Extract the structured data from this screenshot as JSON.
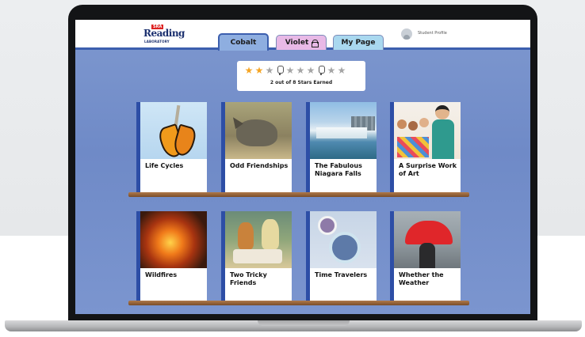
{
  "header": {
    "logo": {
      "badge": "SRA",
      "name": "Reading",
      "sub": "LABORATORY"
    },
    "tabs": [
      {
        "label": "Cobalt",
        "active": true
      },
      {
        "label": "Violet",
        "locked": true
      },
      {
        "label": "My Page"
      }
    ],
    "profile_label": "Student Profile"
  },
  "stars": {
    "earned": 2,
    "total": 8,
    "label": "2 out of 8 Stars Earned"
  },
  "books": [
    {
      "title": "Life Cycles"
    },
    {
      "title": "Odd Friendships"
    },
    {
      "title": "The Fabulous Niagara Falls"
    },
    {
      "title": "A Surprise Work of Art"
    },
    {
      "title": "Wildfires"
    },
    {
      "title": "Two Tricky Friends"
    },
    {
      "title": "Time Travelers"
    },
    {
      "title": "Whether the Weather"
    }
  ],
  "colors": {
    "accent": "#3c5fae",
    "star_earned": "#f5a524",
    "star_empty": "#a5a5a5",
    "tab_cobalt": "#8eaee0",
    "tab_violet": "#e8b9e6",
    "tab_mypage": "#a9d8ef"
  }
}
